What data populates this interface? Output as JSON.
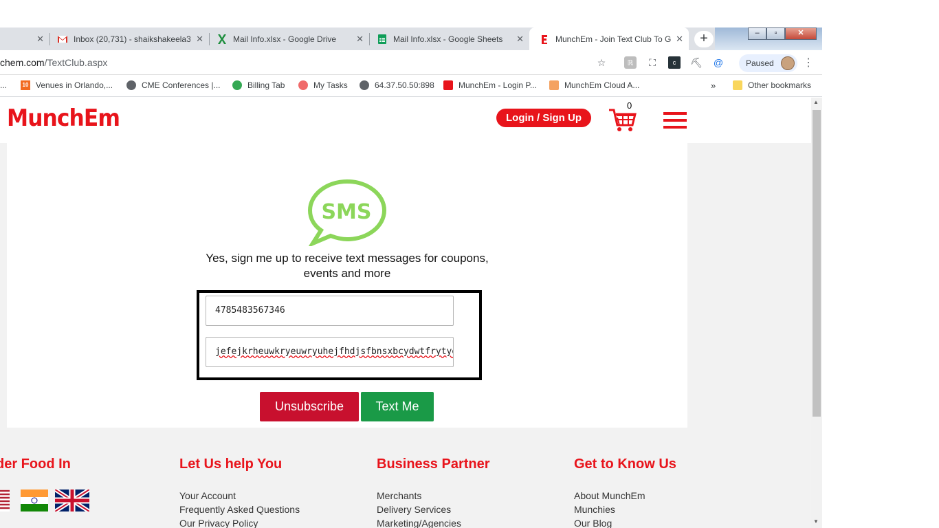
{
  "browser": {
    "tabs": [
      {
        "title": "",
        "active": false
      },
      {
        "title": "Inbox (20,731) - shaikshakeela3(",
        "active": false
      },
      {
        "title": "Mail Info.xlsx - Google Drive",
        "active": false
      },
      {
        "title": "Mail Info.xlsx - Google Sheets",
        "active": false
      },
      {
        "title": "MunchEm - Join Text Club To G",
        "active": true
      }
    ],
    "new_tab_symbol": "+",
    "url_host": "chem.com",
    "url_path": "/TextClub.aspx",
    "profile_status": "Paused",
    "bookmarks": [
      {
        "label": "..."
      },
      {
        "label": "Venues in Orlando,..."
      },
      {
        "label": "CME Conferences |..."
      },
      {
        "label": "Billing Tab"
      },
      {
        "label": "My Tasks"
      },
      {
        "label": "64.37.50.50:898"
      },
      {
        "label": "MunchEm - Login P..."
      },
      {
        "label": "MunchEm Cloud A..."
      }
    ],
    "bookmarks_overflow": "»",
    "other_bookmarks": "Other bookmarks"
  },
  "site": {
    "logo": "MunchEm",
    "login_label": "Login / Sign Up",
    "cart_count": "0",
    "sms_label": "SMS",
    "headline": "Yes, sign me up to receive text messages for coupons, events and more",
    "phone_value": "4785483567346",
    "text_value": "jefejkrheuwkryeuwryuhejfhdjsfbnsxbcydwtfrytyew",
    "unsubscribe_label": "Unsubscribe",
    "textme_label": "Text Me"
  },
  "footer": {
    "columns": [
      {
        "heading": "der Food In",
        "links": []
      },
      {
        "heading": "Let Us help You",
        "links": [
          "Your Account",
          "Frequently Asked Questions",
          "Our Privacy Policy"
        ]
      },
      {
        "heading": "Business Partner",
        "links": [
          "Merchants",
          "Delivery Services",
          "Marketing/Agencies"
        ]
      },
      {
        "heading": "Get to Know Us",
        "links": [
          "About MunchEm",
          "Munchies",
          "Our Blog"
        ]
      }
    ]
  },
  "colors": {
    "brand_red": "#e8141b",
    "unsubscribe_red": "#c8102e",
    "textme_green": "#1a9a47",
    "sms_green": "#8cd65a"
  }
}
